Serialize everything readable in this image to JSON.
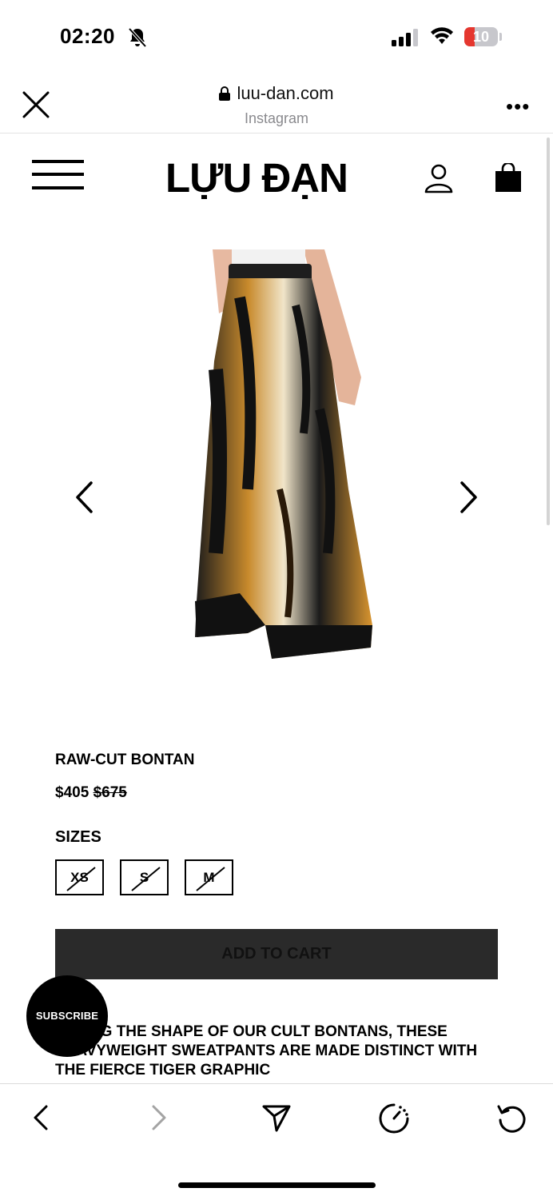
{
  "status_bar": {
    "time": "02:20",
    "battery": "10",
    "icons": [
      "bell-slash-icon",
      "cellular-signal-icon",
      "wifi-icon",
      "battery-icon"
    ]
  },
  "browser": {
    "url": "luu-dan.com",
    "source": "Instagram",
    "more": "•••"
  },
  "site": {
    "logo": "LỰU ĐẠN"
  },
  "product": {
    "title": "RAW-CUT BONTAN",
    "price": "$405",
    "original_price": "$675",
    "sizes_label": "SIZES",
    "sizes": [
      {
        "label": "XS",
        "available": false
      },
      {
        "label": "S",
        "available": false
      },
      {
        "label": "M",
        "available": false
      }
    ],
    "add_to_cart": "ADD TO CART",
    "description": "TAKING THE SHAPE OF OUR CULT BONTANS, THESE HEAVYWEIGHT SWEATPANTS ARE MADE DISTINCT WITH THE FIERCE TIGER GRAPHIC"
  },
  "subscribe": "SUBSCRIBE",
  "colors": {
    "accent": "#000000",
    "add_to_cart_bg": "#2a2a2a",
    "battery_low": "#e5372f"
  }
}
